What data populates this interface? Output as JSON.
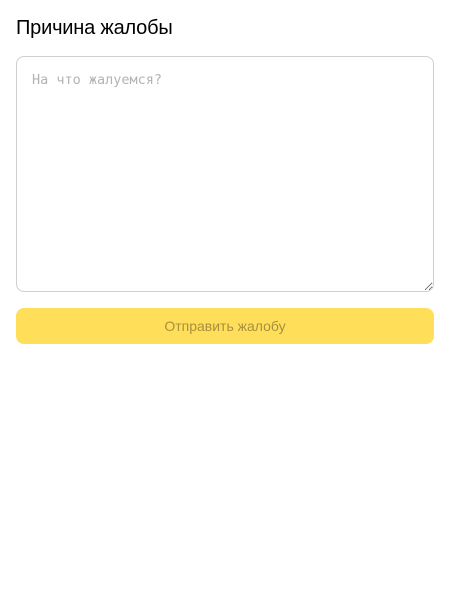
{
  "header": {
    "title": "Причина жалобы"
  },
  "form": {
    "reason_input": {
      "value": "",
      "placeholder": "На что жалуемся?"
    },
    "submit_label": "Отправить жалобу",
    "submit_disabled": true
  },
  "colors": {
    "accent": "#ffdf5a",
    "disabled_text": "#a78f3f",
    "border": "#cfcfcf",
    "placeholder": "#b3b3b3"
  }
}
